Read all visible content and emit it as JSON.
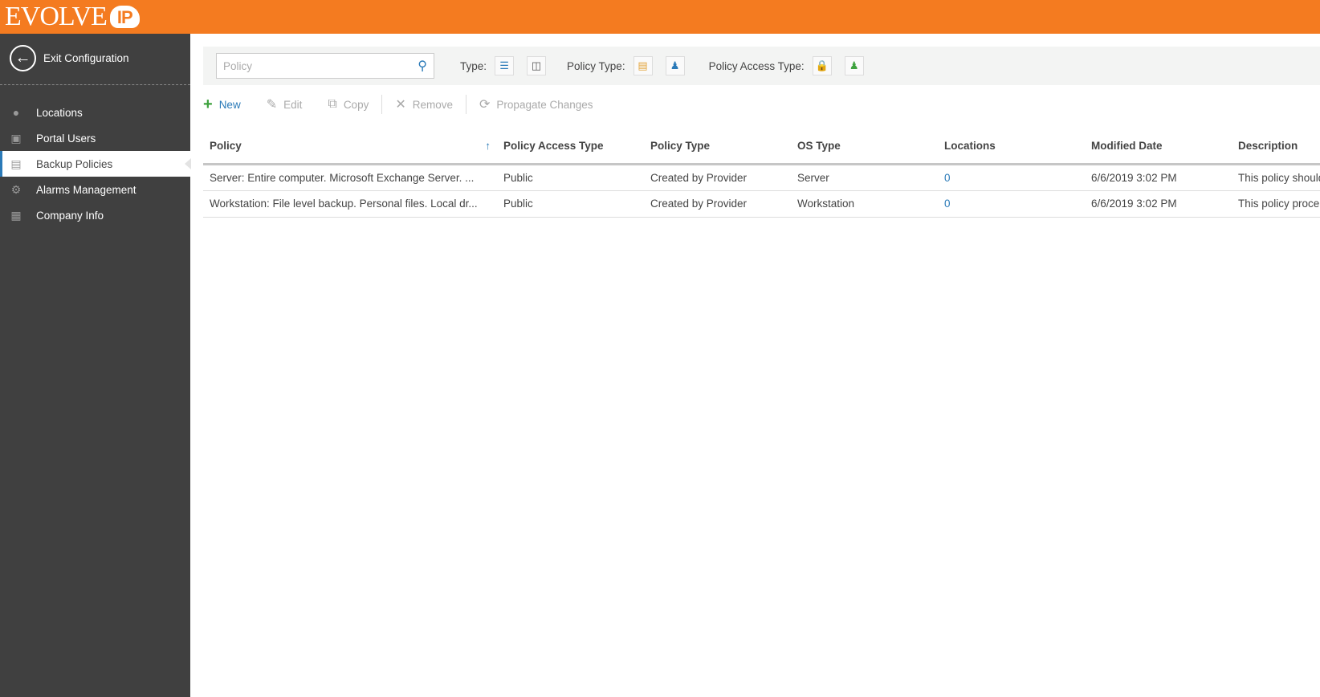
{
  "brand": {
    "name": "EVOLVE",
    "badge": "IP",
    "color": "#f47b20"
  },
  "sidebar": {
    "exit_label": "Exit Configuration",
    "items": [
      {
        "label": "Locations",
        "icon": "map-pin-icon"
      },
      {
        "label": "Portal Users",
        "icon": "user-card-icon"
      },
      {
        "label": "Backup Policies",
        "icon": "document-icon",
        "active": true
      },
      {
        "label": "Alarms Management",
        "icon": "alarm-gear-icon"
      },
      {
        "label": "Company Info",
        "icon": "building-icon"
      }
    ]
  },
  "filters": {
    "search_placeholder": "Policy",
    "type_label": "Type:",
    "policy_type_label": "Policy Type:",
    "access_type_label": "Policy Access Type:"
  },
  "toolbar": {
    "new": "New",
    "edit": "Edit",
    "copy": "Copy",
    "remove": "Remove",
    "propagate": "Propagate Changes"
  },
  "table": {
    "columns": [
      "Policy",
      "Policy Access Type",
      "Policy Type",
      "OS Type",
      "Locations",
      "Modified Date",
      "Description"
    ],
    "sort": {
      "column": "Policy",
      "direction": "ascending"
    },
    "rows": [
      [
        "Server: Entire computer. Microsoft Exchange Server. ...",
        "Public",
        "Created by Provider",
        "Server",
        "0",
        "6/6/2019 3:02 PM",
        "This policy should"
      ],
      [
        "Workstation: File level backup. Personal files. Local dr...",
        "Public",
        "Created by Provider",
        "Workstation",
        "0",
        "6/6/2019 3:02 PM",
        "This policy proce"
      ]
    ]
  }
}
